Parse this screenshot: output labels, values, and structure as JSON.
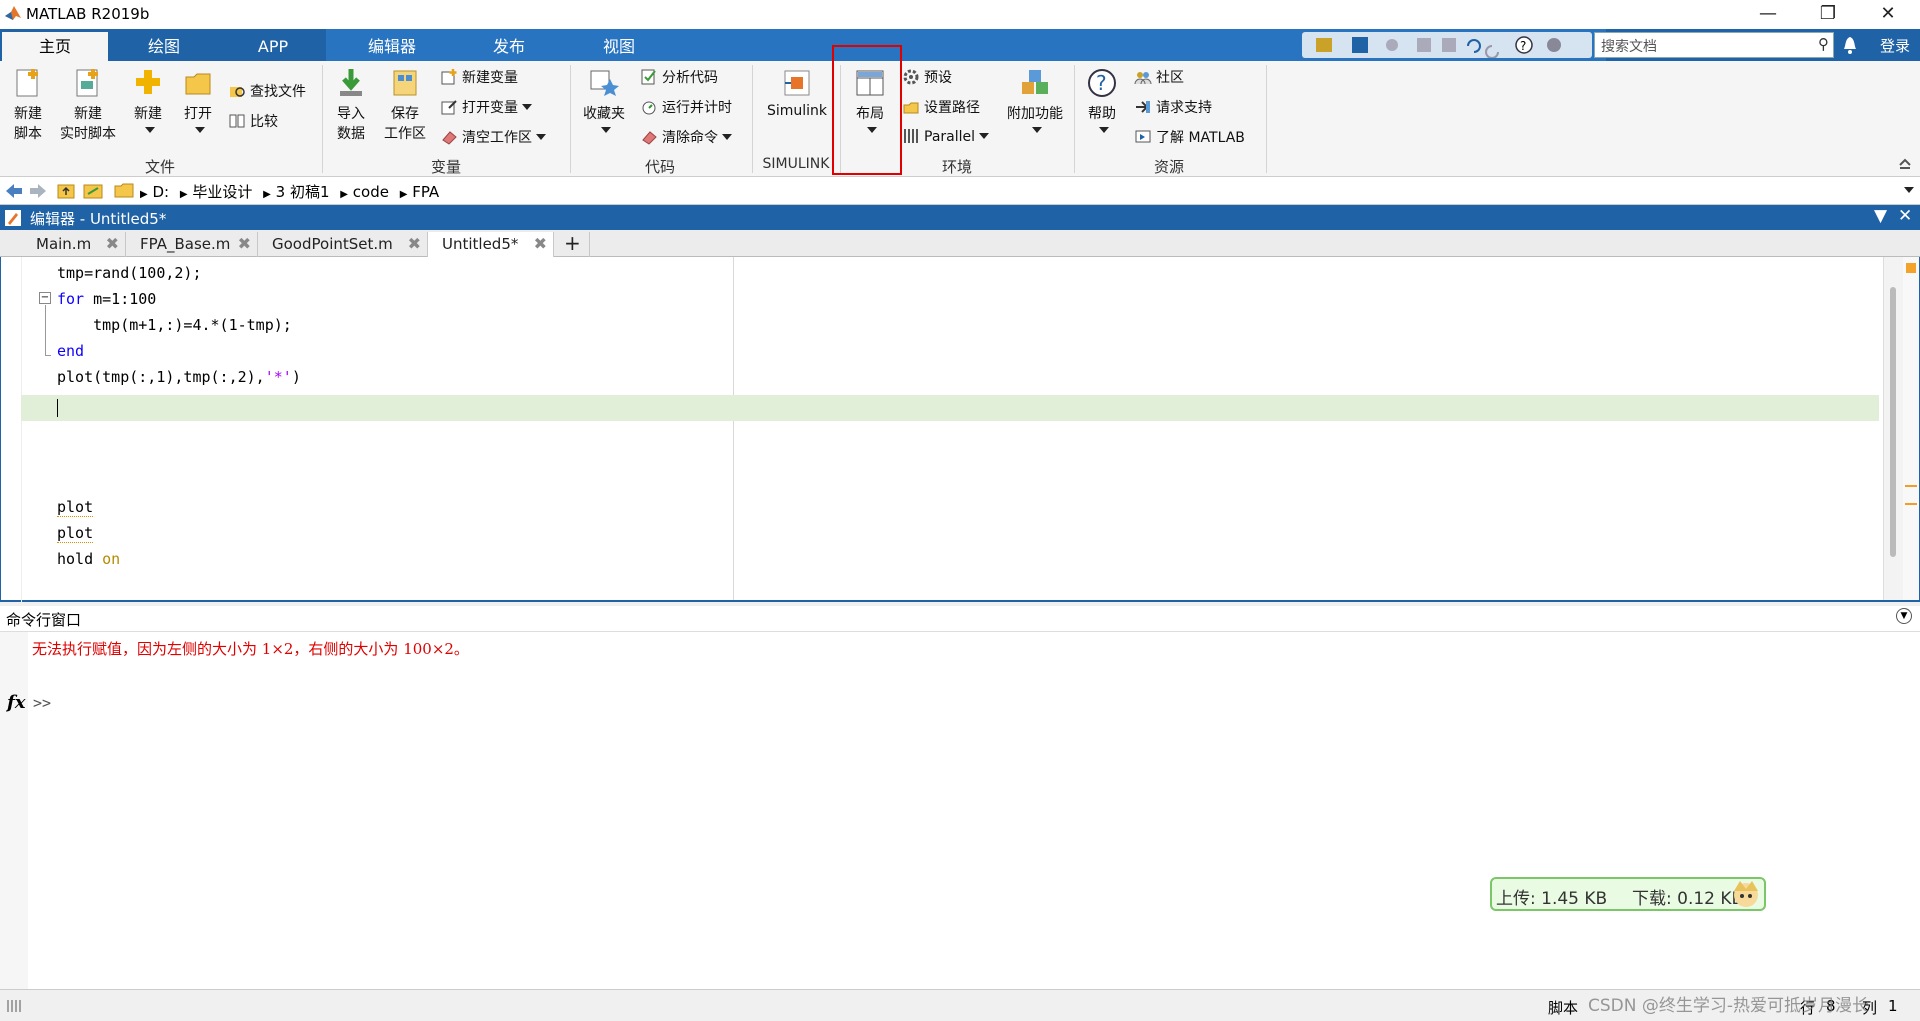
{
  "window": {
    "title": "MATLAB R2019b"
  },
  "ribbon_tabs": [
    "主页",
    "绘图",
    "APP",
    "编辑器",
    "发布",
    "视图"
  ],
  "search": {
    "placeholder": "搜索文档"
  },
  "login": "登录",
  "ribbon": {
    "file": {
      "new_script_1": "新建",
      "new_script_2": "脚本",
      "new_live_1": "新建",
      "new_live_2": "实时脚本",
      "new": "新建",
      "open": "打开",
      "find_files": "查找文件",
      "compare": "比较",
      "section": "文件"
    },
    "variable": {
      "import_1": "导入",
      "import_2": "数据",
      "save_1": "保存",
      "save_2": "工作区",
      "new_var": "新建变量",
      "open_var": "打开变量",
      "clear_ws": "清空工作区",
      "section": "变量"
    },
    "code": {
      "favorites": "收藏夹",
      "analyze": "分析代码",
      "run_time": "运行并计时",
      "clear_cmd": "清除命令",
      "section": "代码"
    },
    "simulink": {
      "label": "Simulink",
      "section": "SIMULINK"
    },
    "env": {
      "layout": "布局",
      "prefs": "预设",
      "set_path": "设置路径",
      "parallel": "Parallel",
      "addons": "附加功能",
      "section": "环境"
    },
    "resources": {
      "help": "帮助",
      "community": "社区",
      "support": "请求支持",
      "learn": "了解 MATLAB",
      "section": "资源"
    }
  },
  "path": [
    "D:",
    "毕业设计",
    "3 初稿1",
    "code",
    "FPA"
  ],
  "editor": {
    "title": "编辑器 - Untitled5*",
    "tabs": [
      "Main.m",
      "FPA_Base.m",
      "GoodPointSet.m",
      "Untitled5*"
    ]
  },
  "code_lines": {
    "l1": "tmp=rand(100,2);",
    "l2_kw": "for",
    "l2_rest": " m=1:100",
    "l3": "    tmp(m+1,:)=4.*(1-tmp);",
    "l4_kw": "end",
    "l5_a": "plot(tmp(:,1),tmp(:,2),",
    "l5_str": "'*'",
    "l5_b": ")",
    "l6": "plot",
    "l7": "plot",
    "l8_a": "hold ",
    "l8_kw": "on"
  },
  "command_window": {
    "title": "命令行窗口",
    "error": "无法执行赋值，因为左侧的大小为 1×2，右侧的大小为 100×2。",
    "prompt": ">>",
    "fx": "fx"
  },
  "net_monitor": {
    "upload": "上传: 1.45 KB",
    "download": "下载: 0.12 KB"
  },
  "status": {
    "mode": "脚本",
    "row_label": "行",
    "row_value": "8",
    "col_label": "列",
    "col_value": "1"
  },
  "watermark": "CSDN @终生学习-热爱可抵岁月漫长",
  "colors": {
    "accent": "#1f62a5",
    "highlight_line": "#e1efd9",
    "error_text": "#e00000",
    "keyword": "#0e00ff",
    "string": "#a709f5",
    "selection_box": "#e00000"
  }
}
